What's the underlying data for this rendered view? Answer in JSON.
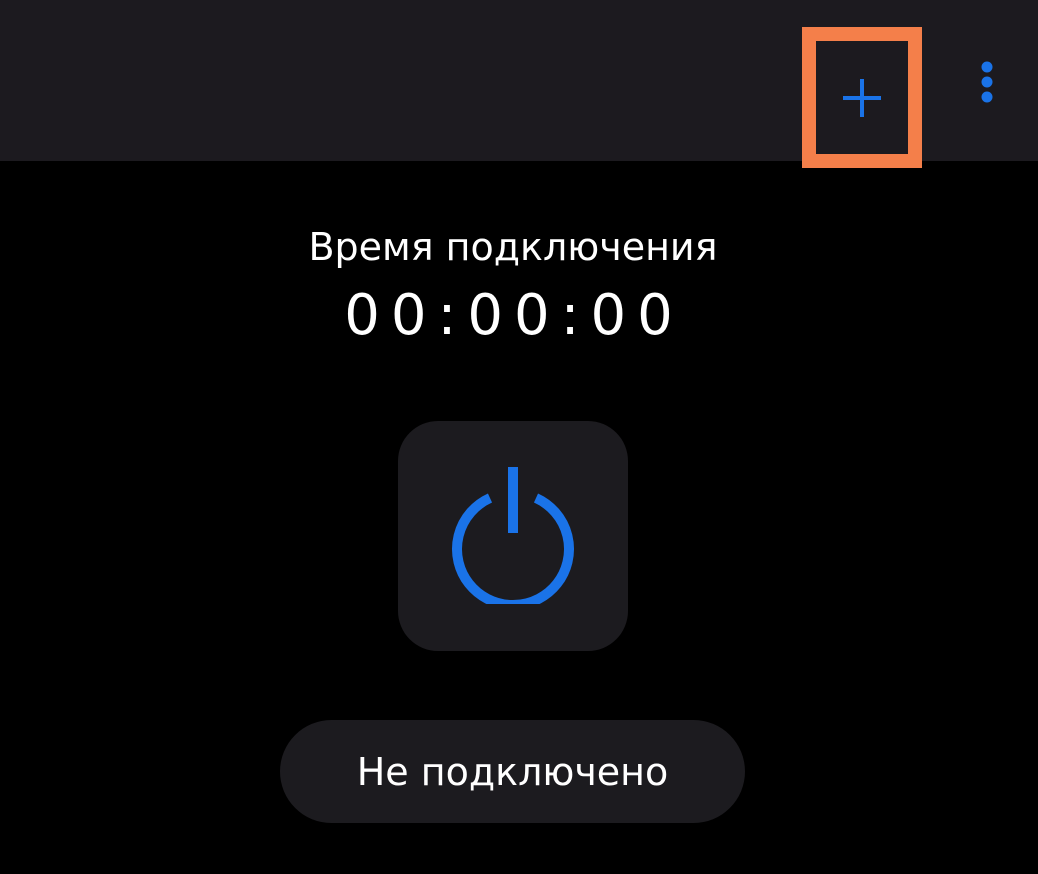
{
  "top_bar": {
    "add_icon": "plus-icon",
    "menu_icon": "more-vertical-icon",
    "accent_color": "#1a73e8",
    "highlight_color": "#f47f4a"
  },
  "main": {
    "connection_time_label": "Время подключения",
    "connection_time_value": "00:00:00",
    "power_icon": "power-icon",
    "status_text": "Не подключено"
  }
}
